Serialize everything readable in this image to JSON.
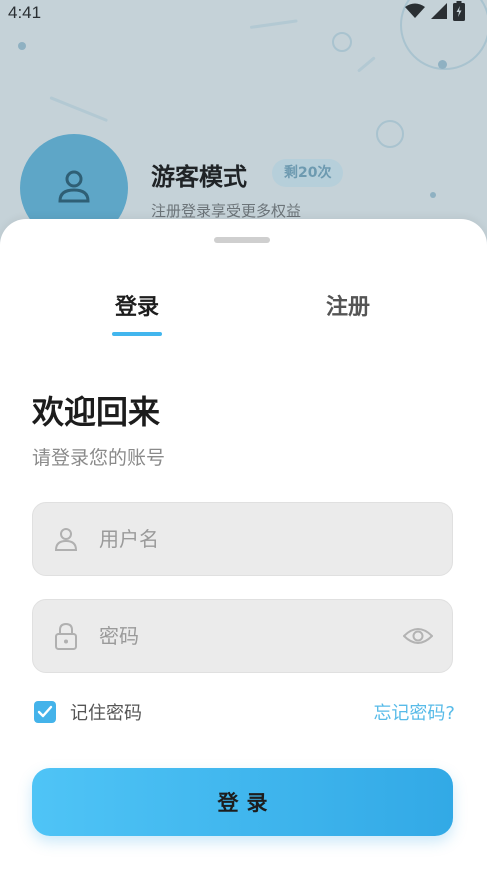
{
  "status_bar": {
    "time": "4:41"
  },
  "guest": {
    "title": "游客模式",
    "badge": "剩20次",
    "subtitle": "注册登录享受更多权益"
  },
  "tabs": [
    {
      "label": "登录",
      "active": true
    },
    {
      "label": "注册",
      "active": false
    }
  ],
  "form": {
    "welcome": "欢迎回来",
    "subtitle": "请登录您的账号",
    "username": {
      "value": "",
      "placeholder": "用户名"
    },
    "password": {
      "value": "",
      "placeholder": "密码"
    },
    "remember_label": "记住密码",
    "remember_checked": true,
    "forgot_label": "忘记密码?",
    "submit_label": "登录"
  },
  "colors": {
    "accent": "#42b6ee",
    "button_start": "#4fc4f6",
    "button_end": "#32a9e6"
  },
  "icons": [
    "wifi-icon",
    "signal-icon",
    "battery-icon",
    "user-icon",
    "lock-icon",
    "eye-icon",
    "checkmark-icon"
  ]
}
